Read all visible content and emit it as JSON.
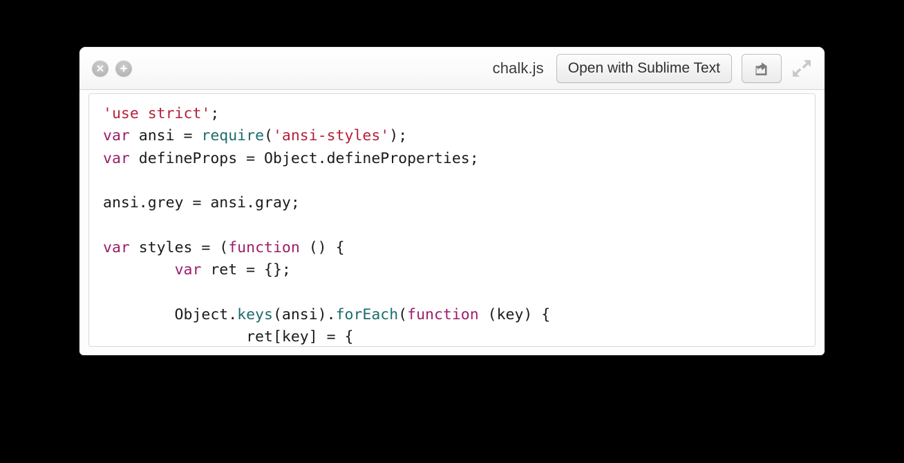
{
  "window": {
    "title": "chalk.js",
    "controls": {
      "close_label": "Close",
      "close_icon": "close-x-icon",
      "add_label": "Add",
      "add_icon": "plus-icon"
    },
    "toolbar": {
      "open_with_label": "Open with Sublime Text",
      "share_icon": "share-export-icon",
      "share_label": "Share",
      "fullscreen_icon": "fullscreen-expand-icon",
      "fullscreen_label": "Full Screen"
    }
  },
  "colors": {
    "background": "#000000",
    "window_bg": "#fdfdfd",
    "titlebar_bg": "#f7f7f7",
    "code_bg": "#ffffff",
    "keyword": "#9b1d69",
    "string": "#b6203a",
    "function": "#1c6b6b",
    "plain_text": "#1a1a1a",
    "border": "#d8d8d8"
  },
  "code": {
    "language": "javascript",
    "filename": "chalk.js",
    "lines": [
      [
        {
          "t": "'use strict'",
          "c": "t-str"
        },
        {
          "t": ";",
          "c": "t-plain"
        }
      ],
      [
        {
          "t": "var",
          "c": "t-kw"
        },
        {
          "t": " ansi = ",
          "c": "t-plain"
        },
        {
          "t": "require",
          "c": "t-fn"
        },
        {
          "t": "(",
          "c": "t-plain"
        },
        {
          "t": "'ansi-styles'",
          "c": "t-str"
        },
        {
          "t": ");",
          "c": "t-plain"
        }
      ],
      [
        {
          "t": "var",
          "c": "t-kw"
        },
        {
          "t": " defineProps = Object.defineProperties;",
          "c": "t-plain"
        }
      ],
      [],
      [
        {
          "t": "ansi.grey = ansi.gray;",
          "c": "t-plain"
        }
      ],
      [],
      [
        {
          "t": "var",
          "c": "t-kw"
        },
        {
          "t": " styles = (",
          "c": "t-plain"
        },
        {
          "t": "function",
          "c": "t-kw"
        },
        {
          "t": " () {",
          "c": "t-plain"
        }
      ],
      [
        {
          "t": "        ",
          "c": "t-plain"
        },
        {
          "t": "var",
          "c": "t-kw"
        },
        {
          "t": " ret = {};",
          "c": "t-plain"
        }
      ],
      [],
      [
        {
          "t": "        Object.",
          "c": "t-plain"
        },
        {
          "t": "keys",
          "c": "t-fn"
        },
        {
          "t": "(ansi).",
          "c": "t-plain"
        },
        {
          "t": "forEach",
          "c": "t-fn"
        },
        {
          "t": "(",
          "c": "t-plain"
        },
        {
          "t": "function",
          "c": "t-kw"
        },
        {
          "t": " (key) {",
          "c": "t-plain"
        }
      ],
      [
        {
          "t": "                ret[key] = {",
          "c": "t-plain"
        }
      ]
    ]
  }
}
